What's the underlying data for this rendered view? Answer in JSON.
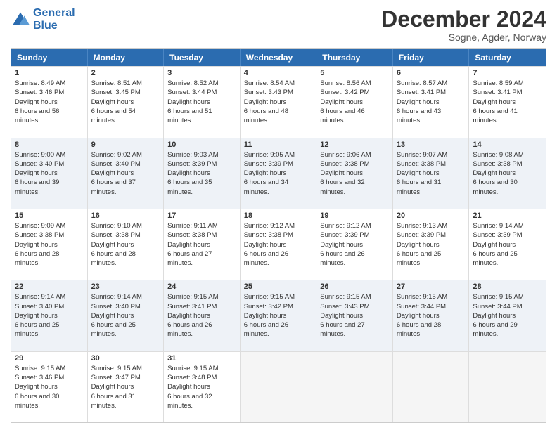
{
  "header": {
    "logo_line1": "General",
    "logo_line2": "Blue",
    "month": "December 2024",
    "location": "Sogne, Agder, Norway"
  },
  "days": [
    "Sunday",
    "Monday",
    "Tuesday",
    "Wednesday",
    "Thursday",
    "Friday",
    "Saturday"
  ],
  "rows": [
    [
      {
        "day": "1",
        "sunrise": "8:49 AM",
        "sunset": "3:46 PM",
        "daylight": "6 hours and 56 minutes."
      },
      {
        "day": "2",
        "sunrise": "8:51 AM",
        "sunset": "3:45 PM",
        "daylight": "6 hours and 54 minutes."
      },
      {
        "day": "3",
        "sunrise": "8:52 AM",
        "sunset": "3:44 PM",
        "daylight": "6 hours and 51 minutes."
      },
      {
        "day": "4",
        "sunrise": "8:54 AM",
        "sunset": "3:43 PM",
        "daylight": "6 hours and 48 minutes."
      },
      {
        "day": "5",
        "sunrise": "8:56 AM",
        "sunset": "3:42 PM",
        "daylight": "6 hours and 46 minutes."
      },
      {
        "day": "6",
        "sunrise": "8:57 AM",
        "sunset": "3:41 PM",
        "daylight": "6 hours and 43 minutes."
      },
      {
        "day": "7",
        "sunrise": "8:59 AM",
        "sunset": "3:41 PM",
        "daylight": "6 hours and 41 minutes."
      }
    ],
    [
      {
        "day": "8",
        "sunrise": "9:00 AM",
        "sunset": "3:40 PM",
        "daylight": "6 hours and 39 minutes."
      },
      {
        "day": "9",
        "sunrise": "9:02 AM",
        "sunset": "3:40 PM",
        "daylight": "6 hours and 37 minutes."
      },
      {
        "day": "10",
        "sunrise": "9:03 AM",
        "sunset": "3:39 PM",
        "daylight": "6 hours and 35 minutes."
      },
      {
        "day": "11",
        "sunrise": "9:05 AM",
        "sunset": "3:39 PM",
        "daylight": "6 hours and 34 minutes."
      },
      {
        "day": "12",
        "sunrise": "9:06 AM",
        "sunset": "3:38 PM",
        "daylight": "6 hours and 32 minutes."
      },
      {
        "day": "13",
        "sunrise": "9:07 AM",
        "sunset": "3:38 PM",
        "daylight": "6 hours and 31 minutes."
      },
      {
        "day": "14",
        "sunrise": "9:08 AM",
        "sunset": "3:38 PM",
        "daylight": "6 hours and 30 minutes."
      }
    ],
    [
      {
        "day": "15",
        "sunrise": "9:09 AM",
        "sunset": "3:38 PM",
        "daylight": "6 hours and 28 minutes."
      },
      {
        "day": "16",
        "sunrise": "9:10 AM",
        "sunset": "3:38 PM",
        "daylight": "6 hours and 28 minutes."
      },
      {
        "day": "17",
        "sunrise": "9:11 AM",
        "sunset": "3:38 PM",
        "daylight": "6 hours and 27 minutes."
      },
      {
        "day": "18",
        "sunrise": "9:12 AM",
        "sunset": "3:38 PM",
        "daylight": "6 hours and 26 minutes."
      },
      {
        "day": "19",
        "sunrise": "9:12 AM",
        "sunset": "3:39 PM",
        "daylight": "6 hours and 26 minutes."
      },
      {
        "day": "20",
        "sunrise": "9:13 AM",
        "sunset": "3:39 PM",
        "daylight": "6 hours and 25 minutes."
      },
      {
        "day": "21",
        "sunrise": "9:14 AM",
        "sunset": "3:39 PM",
        "daylight": "6 hours and 25 minutes."
      }
    ],
    [
      {
        "day": "22",
        "sunrise": "9:14 AM",
        "sunset": "3:40 PM",
        "daylight": "6 hours and 25 minutes."
      },
      {
        "day": "23",
        "sunrise": "9:14 AM",
        "sunset": "3:40 PM",
        "daylight": "6 hours and 25 minutes."
      },
      {
        "day": "24",
        "sunrise": "9:15 AM",
        "sunset": "3:41 PM",
        "daylight": "6 hours and 26 minutes."
      },
      {
        "day": "25",
        "sunrise": "9:15 AM",
        "sunset": "3:42 PM",
        "daylight": "6 hours and 26 minutes."
      },
      {
        "day": "26",
        "sunrise": "9:15 AM",
        "sunset": "3:43 PM",
        "daylight": "6 hours and 27 minutes."
      },
      {
        "day": "27",
        "sunrise": "9:15 AM",
        "sunset": "3:44 PM",
        "daylight": "6 hours and 28 minutes."
      },
      {
        "day": "28",
        "sunrise": "9:15 AM",
        "sunset": "3:44 PM",
        "daylight": "6 hours and 29 minutes."
      }
    ],
    [
      {
        "day": "29",
        "sunrise": "9:15 AM",
        "sunset": "3:46 PM",
        "daylight": "6 hours and 30 minutes."
      },
      {
        "day": "30",
        "sunrise": "9:15 AM",
        "sunset": "3:47 PM",
        "daylight": "6 hours and 31 minutes."
      },
      {
        "day": "31",
        "sunrise": "9:15 AM",
        "sunset": "3:48 PM",
        "daylight": "6 hours and 32 minutes."
      },
      null,
      null,
      null,
      null
    ]
  ]
}
